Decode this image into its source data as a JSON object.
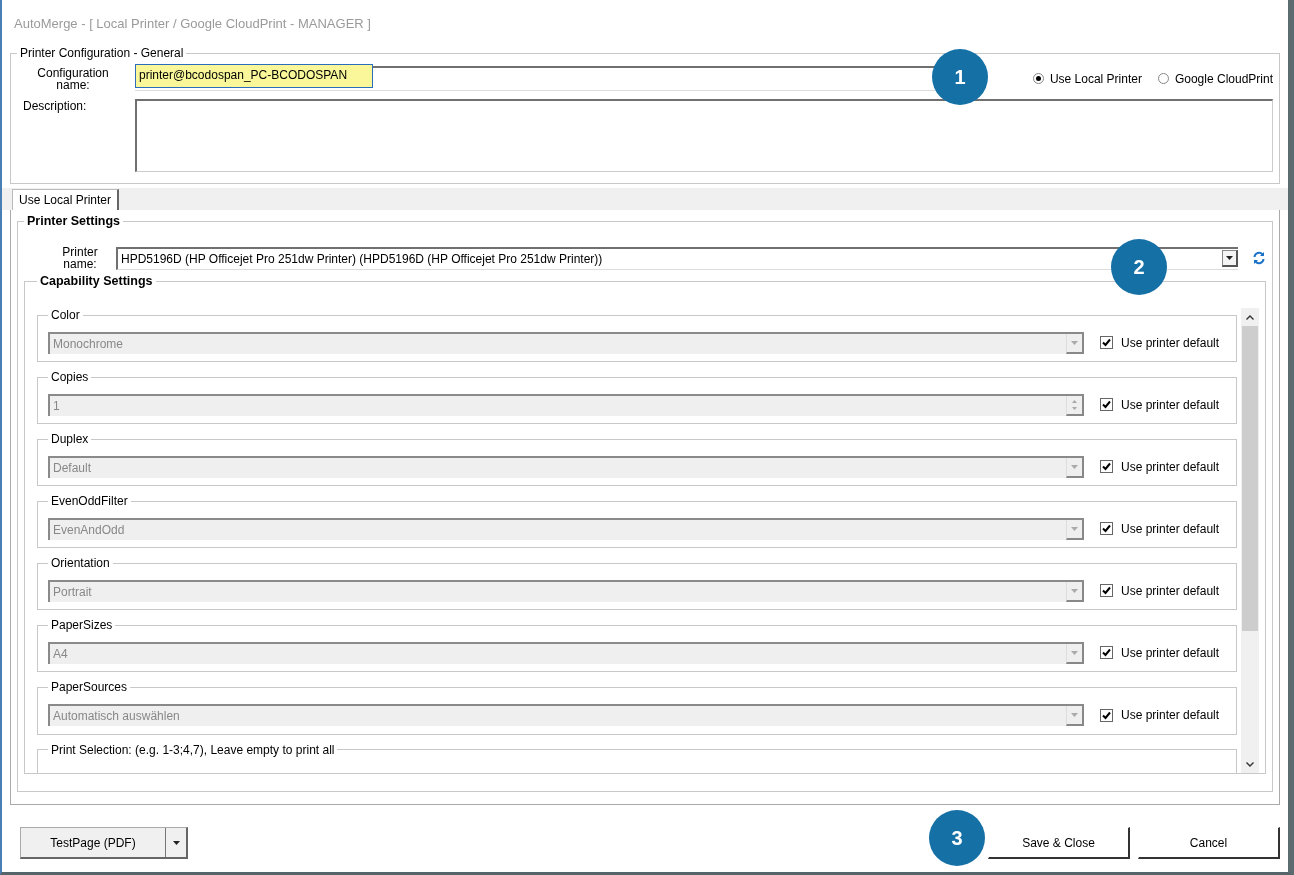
{
  "window": {
    "title": "AutoMerge - [ Local Printer / Google CloudPrint - MANAGER ]"
  },
  "general": {
    "legend": "Printer Configuration - General",
    "config_label": "Configuration name:",
    "config_value": "printer@bcodospan_PC-BCODOSPAN",
    "description_label": "Description:",
    "radios": [
      {
        "label": "Use Local Printer",
        "selected": true
      },
      {
        "label": "Google CloudPrint",
        "selected": false
      }
    ]
  },
  "tabs": [
    {
      "label": "Use Local Printer",
      "selected": true
    }
  ],
  "printer_settings": {
    "legend": "Printer Settings",
    "printer_label": "Printer name:",
    "printer_value": "HPD5196D (HP Officejet Pro 251dw Printer) (HPD5196D (HP Officejet Pro 251dw Printer))"
  },
  "capability_settings": {
    "legend": "Capability Settings",
    "groups": [
      {
        "label": "Color",
        "kind": "select",
        "value": "Monochrome",
        "checkbox_label": "Use printer default",
        "checked": true
      },
      {
        "label": "Copies",
        "kind": "spinner",
        "value": "1",
        "checkbox_label": "Use printer default",
        "checked": true
      },
      {
        "label": "Duplex",
        "kind": "select",
        "value": "Default",
        "checkbox_label": "Use printer default",
        "checked": true
      },
      {
        "label": "EvenOddFilter",
        "kind": "select",
        "value": "EvenAndOdd",
        "checkbox_label": "Use printer default",
        "checked": true
      },
      {
        "label": "Orientation",
        "kind": "select",
        "value": "Portrait",
        "checkbox_label": "Use printer default",
        "checked": true
      },
      {
        "label": "PaperSizes",
        "kind": "select",
        "value": "A4",
        "checkbox_label": "Use printer default",
        "checked": true
      },
      {
        "label": "PaperSources",
        "kind": "select",
        "value": "Automatisch auswählen",
        "checkbox_label": "Use printer default",
        "checked": true
      }
    ],
    "print_selection": {
      "label": "Print Selection: (e.g. 1-3;4,7), Leave empty to print all"
    }
  },
  "footer": {
    "testpage": "TestPage (PDF)",
    "save": "Save & Close",
    "cancel": "Cancel"
  },
  "callouts": [
    {
      "number": "1"
    },
    {
      "number": "2"
    },
    {
      "number": "3"
    }
  ]
}
